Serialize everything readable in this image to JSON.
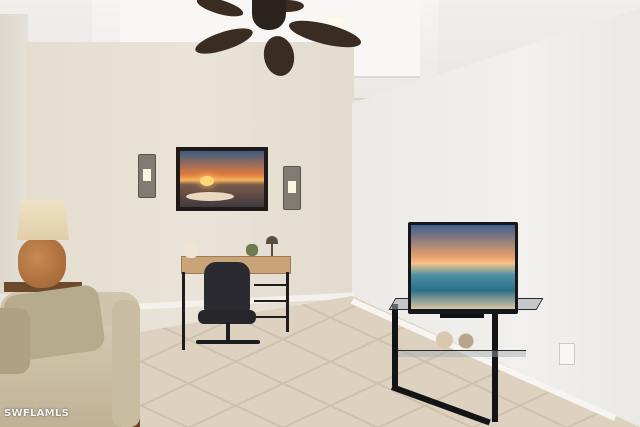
{
  "watermark": {
    "text": "SWFLAMLS"
  },
  "colors": {
    "wall_back": "#e6dfd3",
    "wall_right": "#efeeeb",
    "floor_tile": "#ddd1bf",
    "fan": "#3b2c22",
    "tv_bezel": "#15171b",
    "sofa": "#cfc4ac"
  },
  "objects": [
    "ceiling-fan",
    "wall-painting",
    "wall-sconce",
    "desk",
    "office-chair",
    "table-lamp",
    "sofa",
    "tv",
    "tv-stand",
    "power-outlet"
  ]
}
